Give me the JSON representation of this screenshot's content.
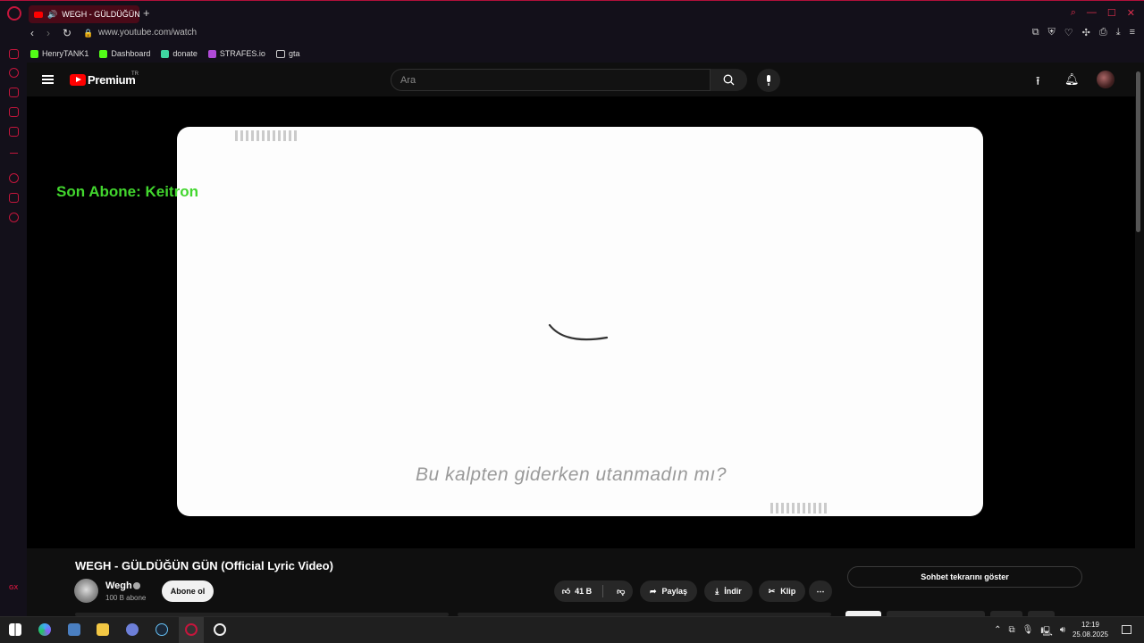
{
  "browser": {
    "tab_title": "WEGH - GÜLDÜĞÜN G",
    "new_tab": "+",
    "url": "www.youtube.com/watch",
    "bookmarks": [
      "HenryTANK1",
      "Dashboard",
      "donate",
      "STRAFES.io",
      "gta"
    ],
    "sidebar_bottom": "GX"
  },
  "youtube": {
    "brand": "Premium",
    "region": "TR",
    "search_placeholder": "Ara"
  },
  "video": {
    "overlay_text": "Son Abone: Keitron",
    "lyric": "Bu kalpten giderken utanmadın mı?",
    "title": "WEGH - GÜLDÜĞÜN GÜN (Official Lyric Video)"
  },
  "channel": {
    "name": "Wegh",
    "subscribers": "100 B abone",
    "subscribe_label": "Abone ol"
  },
  "actions": {
    "likes": "41 B",
    "share": "Paylaş",
    "download": "İndir",
    "clip": "Klip",
    "more": "⋯"
  },
  "chat_replay": "Sohbet tekrarını göster",
  "taskbar": {
    "time": "12:19",
    "date": "25.08.2025"
  },
  "colors": {
    "accent": "#c4163c",
    "youtube_red": "#ff0000",
    "overlay_green": "#42d62e"
  }
}
